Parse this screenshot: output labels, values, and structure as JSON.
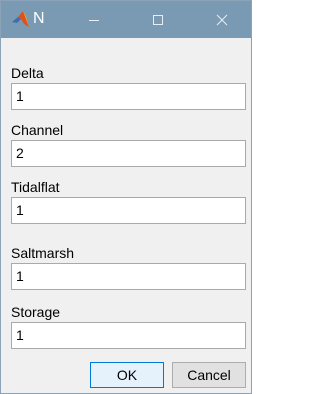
{
  "window": {
    "title": "N",
    "icon": "matlab-icon",
    "accent": "#7a9ab3"
  },
  "titlebar_buttons": {
    "minimize": "minimize-icon",
    "maximize": "maximize-icon",
    "close": "close-icon"
  },
  "fields": [
    {
      "label": "Delta",
      "value": "1"
    },
    {
      "label": "Channel",
      "value": "2"
    },
    {
      "label": "Tidalflat",
      "value": "1"
    },
    {
      "label": "Saltmarsh",
      "value": "1"
    },
    {
      "label": "Storage",
      "value": "1"
    }
  ],
  "buttons": {
    "ok": "OK",
    "cancel": "Cancel"
  }
}
